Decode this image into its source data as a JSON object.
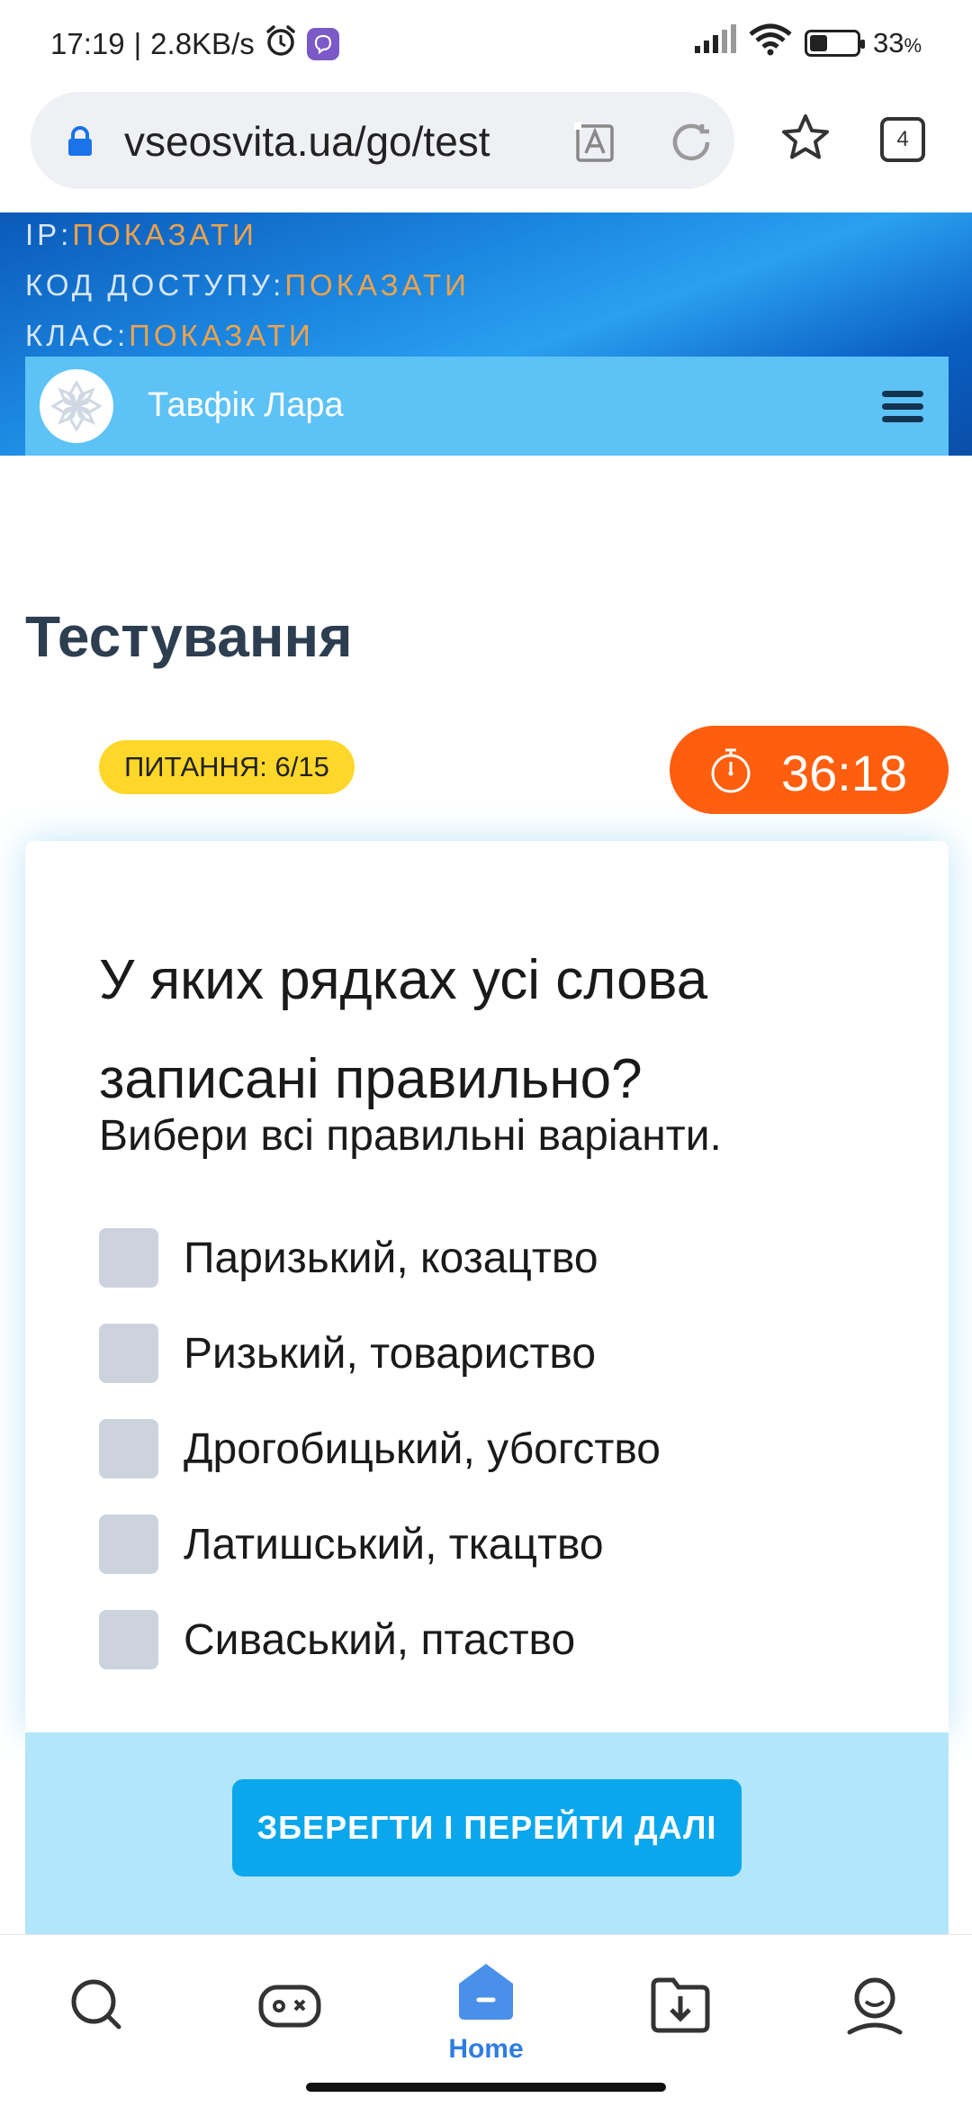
{
  "status_bar": {
    "time": "17:19",
    "speed": "2.8KB/s",
    "battery": "33",
    "battery_unit": "%",
    "battery_level": 0.33
  },
  "browser": {
    "url": "vseosvita.ua/go/test",
    "tab_count": "4"
  },
  "header": {
    "ip_label": "IP:",
    "ip_value": "ПОКАЗАТИ",
    "code_label": "КОД ДОСТУПУ:",
    "code_value": "ПОКАЗАТИ",
    "class_label": "КЛАС:",
    "class_value": "ПОКАЗАТИ",
    "user_name": "Тавфік Лара"
  },
  "page": {
    "title": "Тестування",
    "question_counter": "ПИТАННЯ: 6/15",
    "timer": "36:18"
  },
  "question": {
    "text": "У яких рядках усі слова записані правильно?",
    "hint": "Вибери всі правильні варіанти.",
    "options": [
      {
        "label": "Паризький, козацтво",
        "checked": false
      },
      {
        "label": "Ризький, товариство",
        "checked": false
      },
      {
        "label": "Дрогобицький, убогство",
        "checked": false
      },
      {
        "label": "Латишський, ткацтво",
        "checked": false
      },
      {
        "label": "Сиваський, птаство",
        "checked": false
      }
    ],
    "submit_label": "ЗБЕРЕГТИ І ПЕРЕЙТИ ДАЛІ"
  },
  "bottom_nav": {
    "home_label": "Home",
    "items": [
      "search-icon",
      "gamepad-icon",
      "home-icon",
      "download-icon",
      "profile-icon"
    ],
    "active": "home"
  },
  "colors": {
    "timer_bg": "#ff5e0e",
    "badge_bg": "#ffd72a",
    "button_bg": "#0aa7ec",
    "accent": "#2f7de1",
    "header_value": "#f0a24a"
  }
}
